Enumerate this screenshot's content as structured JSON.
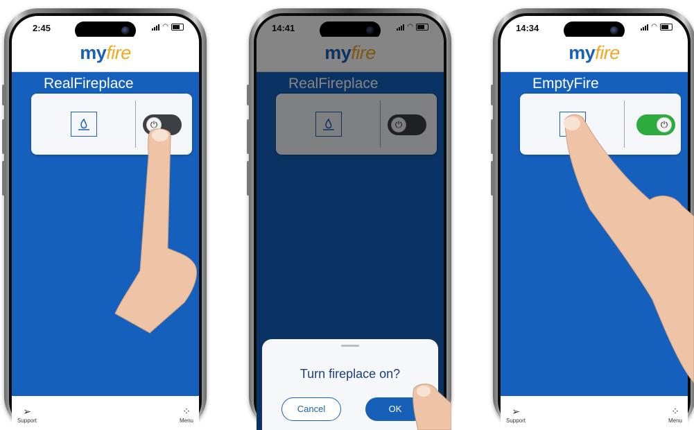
{
  "colors": {
    "brand_blue": "#1560bd",
    "logo_gold": "#f0a820",
    "toggle_off": "#3c3f44",
    "toggle_on": "#2eab3f"
  },
  "phones": [
    {
      "status_time": "2:45",
      "logo_part1": "my",
      "logo_part2": "fire",
      "device_name": "RealFireplace",
      "fireplace_icon": "flame-in-box-icon",
      "power_icon": "⏻",
      "toggle_state": "off",
      "nav_support_label": "Support",
      "nav_menu_label": "Menu"
    },
    {
      "status_time": "14:41",
      "logo_part1": "my",
      "logo_part2": "fire",
      "device_name": "RealFireplace",
      "fireplace_icon": "flame-in-box-icon",
      "power_icon": "⏻",
      "toggle_state": "off",
      "dialog": {
        "message": "Turn fireplace on?",
        "cancel_label": "Cancel",
        "ok_label": "OK"
      }
    },
    {
      "status_time": "14:34",
      "logo_part1": "my",
      "logo_part2": "fire",
      "device_name": "EmptyFire",
      "fireplace_icon": "flame-in-box-icon",
      "power_icon": "⏻",
      "toggle_state": "on",
      "nav_support_label": "Support",
      "nav_menu_label": "Menu"
    }
  ]
}
